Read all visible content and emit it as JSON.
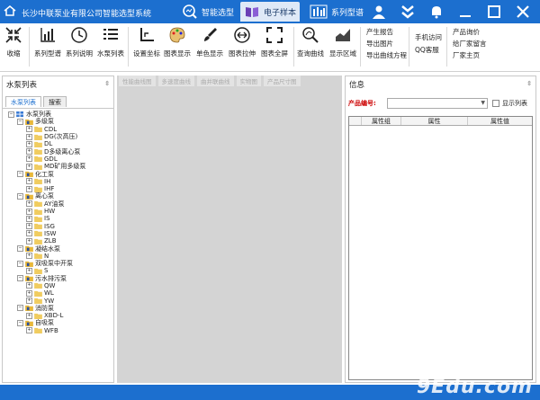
{
  "window": {
    "title": "长沙中联泵业有限公司智能选型系统",
    "modes": [
      {
        "label": "智能选型",
        "icon": "magnifier-chart-icon",
        "active": false
      },
      {
        "label": "电子样本",
        "icon": "book-icon",
        "active": true
      },
      {
        "label": "系列型谱",
        "icon": "bar-chart-icon",
        "active": false
      }
    ]
  },
  "toolbar": {
    "buttons": [
      {
        "label": "收缩",
        "icon": "collapse-arrows-icon"
      },
      {
        "label": "系列型谱",
        "icon": "series-chart-icon"
      },
      {
        "label": "系列说明",
        "icon": "clock-info-icon"
      },
      {
        "label": "水泵列表",
        "icon": "list-icon"
      },
      {
        "label": "设置坐标",
        "icon": "axis-icon"
      },
      {
        "label": "图表显示",
        "icon": "palette-icon"
      },
      {
        "label": "单色显示",
        "icon": "brush-icon"
      },
      {
        "label": "图表拉伸",
        "icon": "stretch-icon"
      },
      {
        "label": "图表全屏",
        "icon": "fullscreen-icon"
      },
      {
        "label": "查询曲线",
        "icon": "search-curve-icon"
      },
      {
        "label": "显示区域",
        "icon": "area-chart-icon"
      }
    ],
    "links_col1": [
      "产生报告",
      "导出图片",
      "导出曲线方程"
    ],
    "links_col2": [
      "手机访问",
      "QQ客服"
    ],
    "links_col3": [
      "产品询价",
      "给厂家留言",
      "厂家主页"
    ]
  },
  "left_panel": {
    "title": "水泵列表",
    "tabs": [
      "水泵列表",
      "搜索"
    ],
    "tree": [
      {
        "level": 0,
        "label": "水泵列表",
        "type": "root"
      },
      {
        "level": 1,
        "label": "多级泵",
        "type": "folder"
      },
      {
        "level": 2,
        "label": "CDL",
        "type": "item"
      },
      {
        "level": 2,
        "label": "DG(次高压)",
        "type": "item"
      },
      {
        "level": 2,
        "label": "DL",
        "type": "item"
      },
      {
        "level": 2,
        "label": "D多级离心泵",
        "type": "item"
      },
      {
        "level": 2,
        "label": "GDL",
        "type": "item"
      },
      {
        "level": 2,
        "label": "MD矿用多级泵",
        "type": "item"
      },
      {
        "level": 1,
        "label": "化工泵",
        "type": "folder"
      },
      {
        "level": 2,
        "label": "IH",
        "type": "item"
      },
      {
        "level": 2,
        "label": "IHF",
        "type": "item"
      },
      {
        "level": 1,
        "label": "离心泵",
        "type": "folder"
      },
      {
        "level": 2,
        "label": "AY油泵",
        "type": "item"
      },
      {
        "level": 2,
        "label": "HW",
        "type": "item"
      },
      {
        "level": 2,
        "label": "IS",
        "type": "item"
      },
      {
        "level": 2,
        "label": "ISG",
        "type": "item"
      },
      {
        "level": 2,
        "label": "ISW",
        "type": "item"
      },
      {
        "level": 2,
        "label": "ZLB",
        "type": "item"
      },
      {
        "level": 1,
        "label": "凝结水泵",
        "type": "folder"
      },
      {
        "level": 2,
        "label": "N",
        "type": "item"
      },
      {
        "level": 1,
        "label": "双吸泵中开泵",
        "type": "folder"
      },
      {
        "level": 2,
        "label": "S",
        "type": "item"
      },
      {
        "level": 1,
        "label": "污水排污泵",
        "type": "folder"
      },
      {
        "level": 2,
        "label": "QW",
        "type": "item"
      },
      {
        "level": 2,
        "label": "WL",
        "type": "item"
      },
      {
        "level": 2,
        "label": "YW",
        "type": "item"
      },
      {
        "level": 1,
        "label": "消防泵",
        "type": "folder"
      },
      {
        "level": 2,
        "label": "XBD-L",
        "type": "item"
      },
      {
        "level": 1,
        "label": "自吸泵",
        "type": "folder"
      },
      {
        "level": 2,
        "label": "WFB",
        "type": "item"
      }
    ]
  },
  "center_panel": {
    "tabs": [
      "性能曲线图",
      "多速度曲线",
      "曲并联曲线",
      "实物图",
      "产品尺寸图"
    ]
  },
  "right_panel": {
    "title": "信息",
    "product_label": "产品编号:",
    "product_value": "",
    "show_list_label": "显示列表",
    "columns": [
      "属性组",
      "属性",
      "属性值"
    ]
  },
  "watermark": "9Edu.com",
  "colors": {
    "titlebar": "#1c6fcf",
    "accent": "#1c6fcf"
  }
}
